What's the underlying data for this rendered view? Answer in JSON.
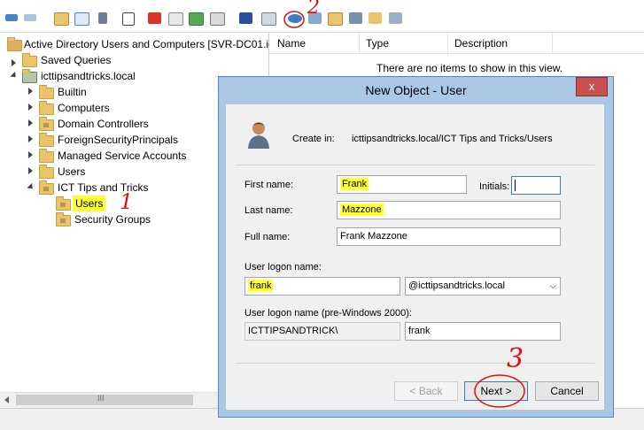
{
  "toolbar": {
    "icons": [
      "back-icon",
      "forward-icon",
      "up-icon",
      "show-tree-icon",
      "properties-icon",
      "delete-icon",
      "export-icon",
      "refresh-icon",
      "help-icon",
      "new-user-icon",
      "new-group-icon",
      "new-ou-icon",
      "filter-icon",
      "find-icon"
    ]
  },
  "tree": {
    "root": "Active Directory Users and Computers [SVR-DC01.ic",
    "saved_queries": "Saved Queries",
    "domain": "icttipsandtricks.local",
    "children": [
      "Builtin",
      "Computers",
      "Domain Controllers",
      "ForeignSecurityPrincipals",
      "Managed Service Accounts",
      "Users",
      "ICT Tips and Tricks"
    ],
    "ict_children": [
      "Users",
      "Security Groups"
    ]
  },
  "list": {
    "columns": [
      "Name",
      "Type",
      "Description"
    ],
    "empty_message": "There are no items to show in this view."
  },
  "dialog": {
    "title": "New Object - User",
    "close_label": "x",
    "create_in_label": "Create in:",
    "create_in_path": "icttipsandtricks.local/ICT Tips and Tricks/Users",
    "first_name_label": "First name:",
    "first_name": "Frank",
    "initials_label": "Initials:",
    "initials": "",
    "last_name_label": "Last name:",
    "last_name": "Mazzone",
    "full_name_label": "Full name:",
    "full_name": "Frank Mazzone",
    "logon_label": "User logon name:",
    "logon_name": "frank",
    "domain_suffix": "@icttipsandtricks.local",
    "pre2000_label": "User logon name (pre-Windows 2000):",
    "pre2000_domain": "ICTTIPSANDTRICK\\",
    "pre2000_name": "frank",
    "back_label": "< Back",
    "next_label": "Next >",
    "cancel_label": "Cancel"
  },
  "annotations": {
    "one": "1",
    "two": "2",
    "three": "3"
  },
  "scrollbar": {
    "thumb_label": "III"
  }
}
